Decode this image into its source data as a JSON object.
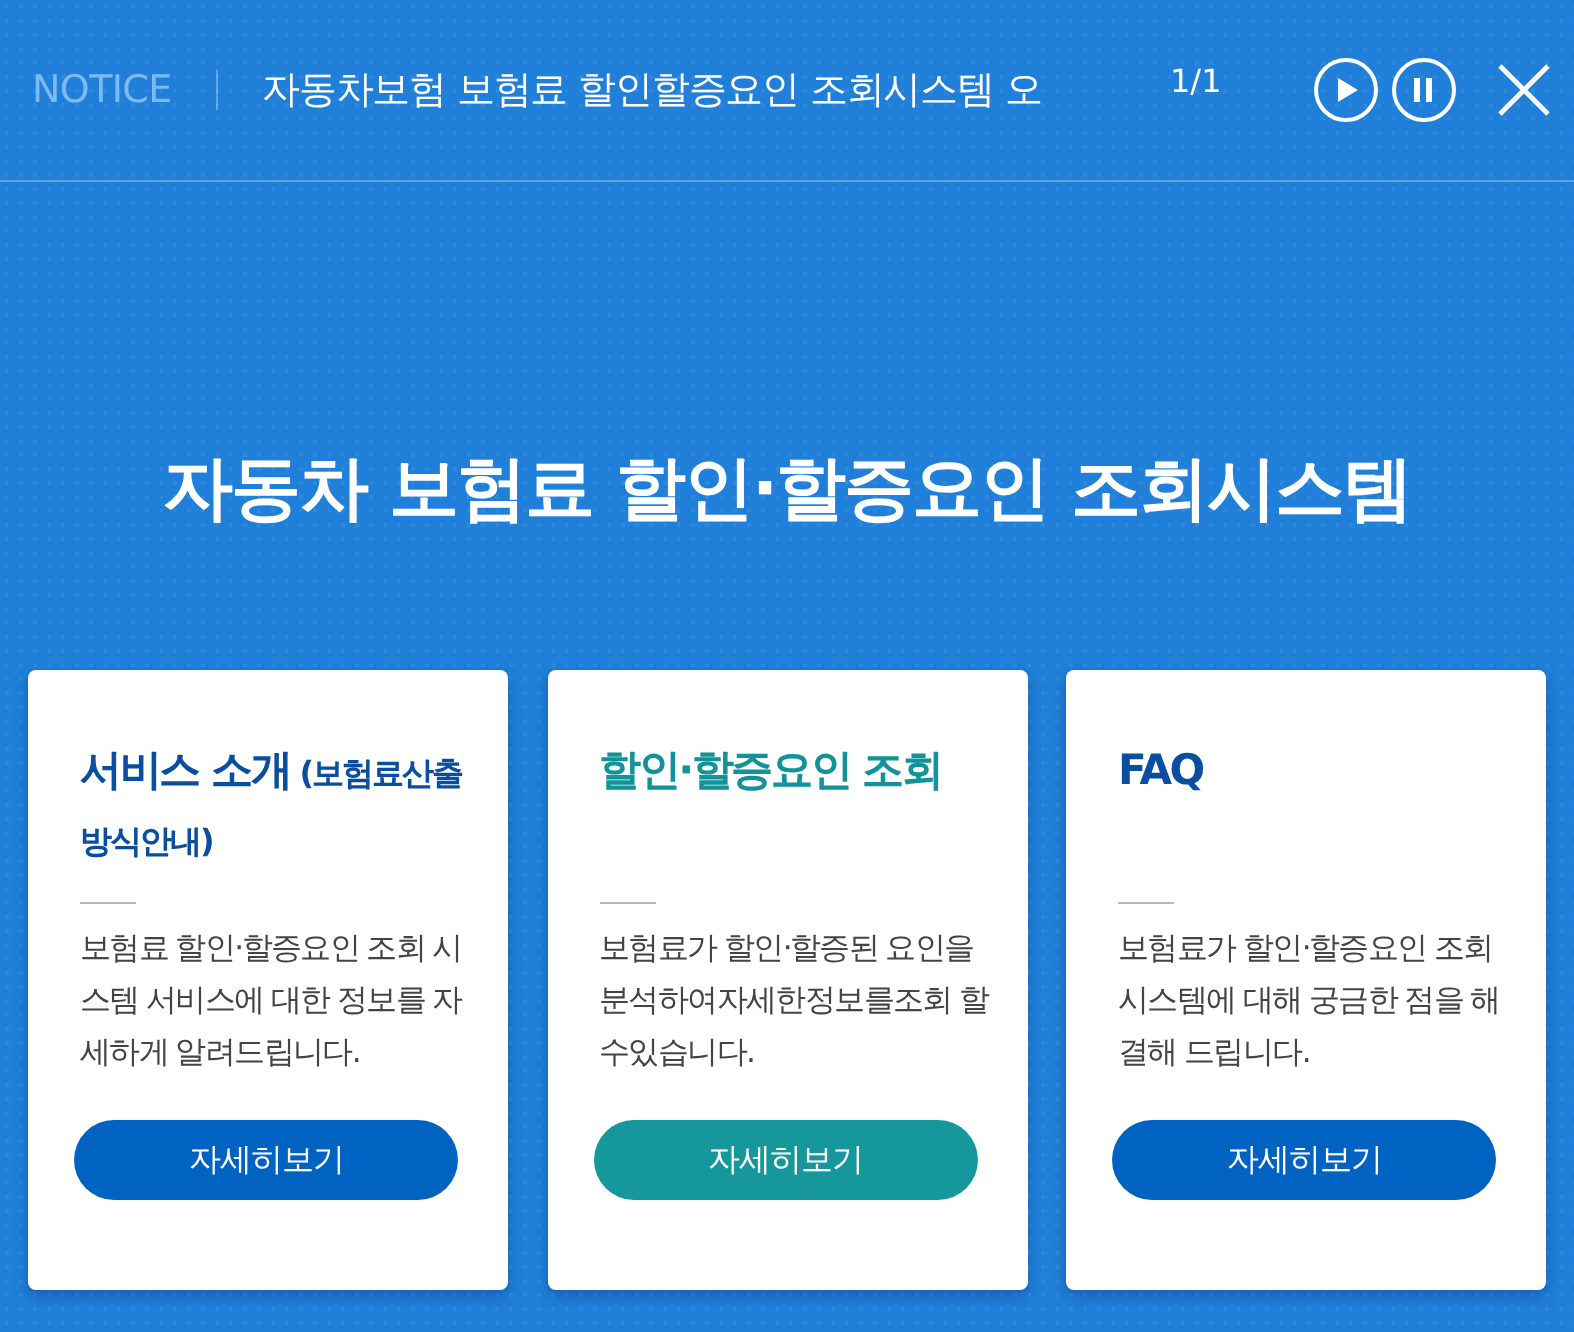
{
  "notice_bar": {
    "label": "NOTICE",
    "ticker_text": "자동차보험 보험료 할인할증요인 조회시스템 오",
    "counter": "1/1"
  },
  "heading": "자동차 보험료 할인·할증요인 조회시스템",
  "cards": [
    {
      "title": "서비스 소개",
      "title_note": "(보험료산출 방식안내)",
      "description": "보험료 할인·할증요인 조회 시스템 서비스에 대한 정보를 자세하게 알려드립니다.",
      "button": "자세히보기",
      "selected": false
    },
    {
      "title": "할인·할증요인 조회",
      "description": "보험료가 할인·할증된 요인을 분석하여자세한정보를조회 할수있습니다.",
      "button": "자세히보기",
      "selected": true
    },
    {
      "title": "FAQ",
      "description": "보험료가 할인·할증요인 조회 시스템에 대해 궁금한 점을 해결해 드립니다.",
      "button": "자세히보기",
      "selected": false
    }
  ]
}
